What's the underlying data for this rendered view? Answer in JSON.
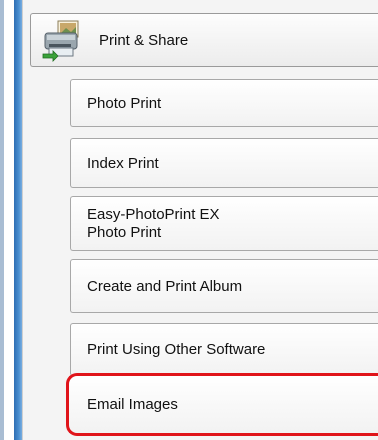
{
  "menu": {
    "header": {
      "label": "Print & Share",
      "icon": "printer-share-icon"
    },
    "items": [
      {
        "label": "Photo Print"
      },
      {
        "label": "Index Print"
      },
      {
        "line1": "Easy-PhotoPrint EX",
        "line2": "Photo Print"
      },
      {
        "label": "Create and Print Album"
      },
      {
        "label": "Print Using Other Software"
      },
      {
        "label": "Email Images",
        "highlight_color": "#e0141a"
      }
    ]
  }
}
